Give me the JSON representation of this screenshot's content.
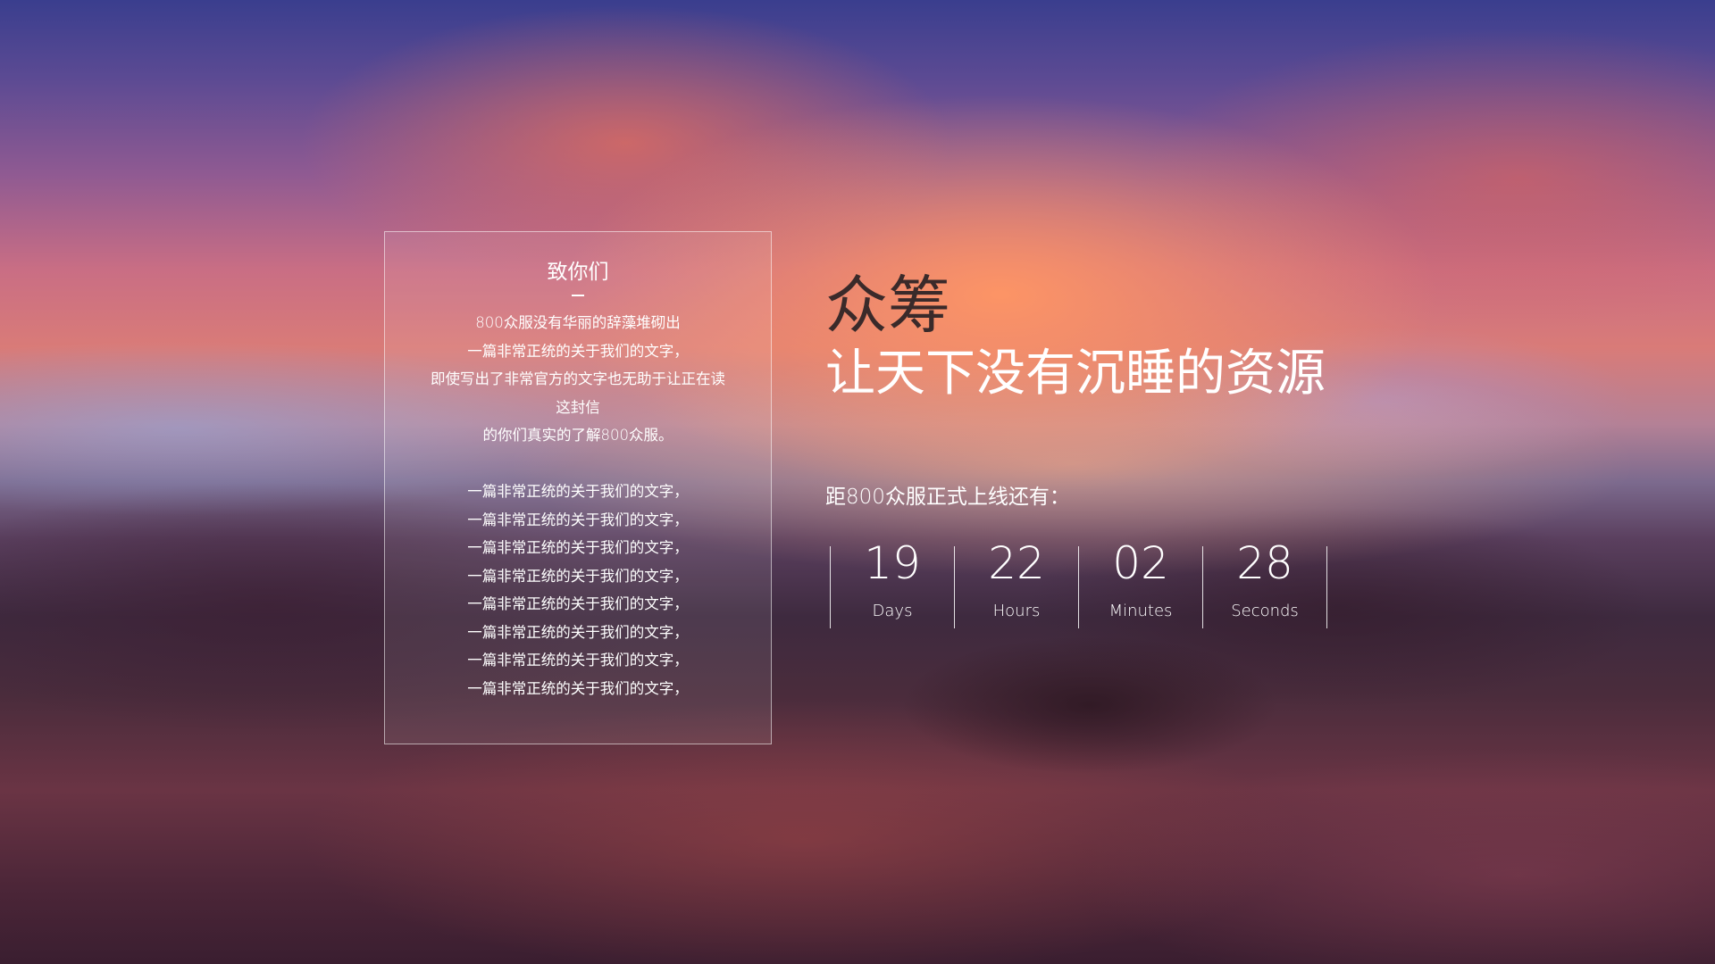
{
  "letter": {
    "title": "致你们",
    "intro_lines": [
      "800众服没有华丽的辞藻堆砌出",
      "一篇非常正统的关于我们的文字，",
      "即使写出了非常官方的文字也无助于让正在读",
      "这封信",
      "的你们真实的了解800众服。"
    ],
    "body_lines": [
      "一篇非常正统的关于我们的文字，",
      "一篇非常正统的关于我们的文字，",
      "一篇非常正统的关于我们的文字，",
      "一篇非常正统的关于我们的文字，",
      "一篇非常正统的关于我们的文字，",
      "一篇非常正统的关于我们的文字，",
      "一篇非常正统的关于我们的文字，",
      "一篇非常正统的关于我们的文字，"
    ]
  },
  "headline": {
    "main": "众筹",
    "sub": "让天下没有沉睡的资源"
  },
  "countdown": {
    "label": "距800众服正式上线还有：",
    "units": [
      {
        "value": "19",
        "name": "Days"
      },
      {
        "value": "22",
        "name": "Hours"
      },
      {
        "value": "02",
        "name": "Minutes"
      },
      {
        "value": "28",
        "name": "Seconds"
      }
    ]
  }
}
